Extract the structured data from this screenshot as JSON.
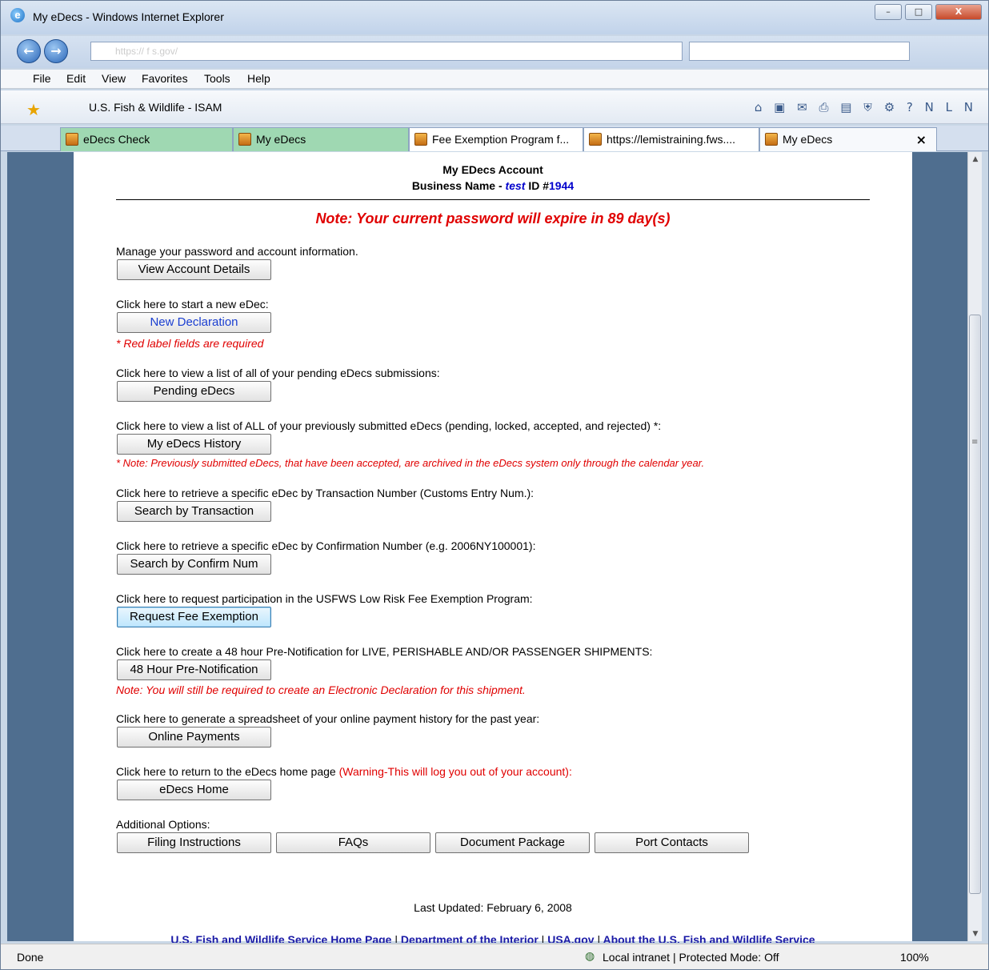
{
  "window": {
    "title": "My eDecs - Windows Internet Explorer",
    "minimize": "–",
    "maximize": "□",
    "close": "X"
  },
  "address": {
    "url": "https://                    f   s.gov/",
    "back": "←",
    "forward": "→"
  },
  "menu": {
    "file": "File",
    "edit": "Edit",
    "view": "View",
    "favorites": "Favorites",
    "tools": "Tools",
    "help": "Help"
  },
  "favorites": {
    "item": "U.S. Fish & Wildlife - ISAM"
  },
  "tabs": [
    {
      "label": "eDecs Check"
    },
    {
      "label": "My eDecs"
    },
    {
      "label": "Fee Exemption Program f..."
    },
    {
      "label": "https://lemistraining.fws...."
    },
    {
      "label": "My eDecs"
    }
  ],
  "tab_close": "×",
  "header": {
    "title": "My EDecs Account",
    "business_label": "Business Name -",
    "business_name": "test",
    "id_label": "ID #",
    "id_value": "1944"
  },
  "password_warning": "Note: Your current password will expire in 89 day(s)",
  "sections": {
    "account": {
      "text": "Manage your password and account information.",
      "button": "View Account Details"
    },
    "new_dec": {
      "text": "Click here to start a new eDec:",
      "button": "New Declaration",
      "note": "* Red label fields are required"
    },
    "pending": {
      "text": "Click here to view a list of all of your pending eDecs submissions:",
      "button": "Pending eDecs"
    },
    "history": {
      "text": "Click here to view a list of ALL of your previously submitted eDecs (pending, locked, accepted, and rejected) *:",
      "button": "My eDecs History",
      "note": "* Note: Previously submitted eDecs, that have been accepted, are archived in the eDecs system only through the calendar year."
    },
    "transaction": {
      "text": "Click here to retrieve a specific eDec by Transaction Number (Customs Entry Num.):",
      "button": "Search by Transaction"
    },
    "confirm": {
      "text": "Click here to retrieve a specific eDec by Confirmation Number (e.g. 2006NY100001):",
      "button": "Search by Confirm Num"
    },
    "fee": {
      "text": "Click here to request participation in the USFWS Low Risk Fee Exemption Program:",
      "button": "Request Fee Exemption"
    },
    "prenotify": {
      "text": "Click here to create a 48 hour Pre-Notification for LIVE, PERISHABLE AND/OR PASSENGER SHIPMENTS:",
      "button": "48 Hour Pre-Notification",
      "note": "Note: You will still be required to create an Electronic Declaration for this shipment."
    },
    "payments": {
      "text": "Click here to generate a spreadsheet of your online payment history for the past year:",
      "button": "Online Payments"
    },
    "home": {
      "text": "Click here to return to the eDecs home page ",
      "warning": "(Warning-This will log you out of your account):",
      "button": "eDecs Home"
    }
  },
  "additional": {
    "label": "Additional Options:",
    "buttons": [
      "Filing Instructions",
      "FAQs",
      "Document Package",
      "Port Contacts"
    ]
  },
  "last_updated": "Last Updated: February 6, 2008",
  "footer_links": [
    "U.S. Fish and Wildlife Service Home Page",
    "Department of the Interior",
    "USA.gov",
    "About the U.S. Fish and Wildlife Service"
  ],
  "footer_sep": "|",
  "status": {
    "left": "Done",
    "zone": "Local intranet | Protected Mode: Off",
    "zoom": "100%"
  },
  "colors": {
    "accent_red": "#e00000",
    "link_blue": "#1a1aa6",
    "page_bg": "#4f6e8f"
  }
}
